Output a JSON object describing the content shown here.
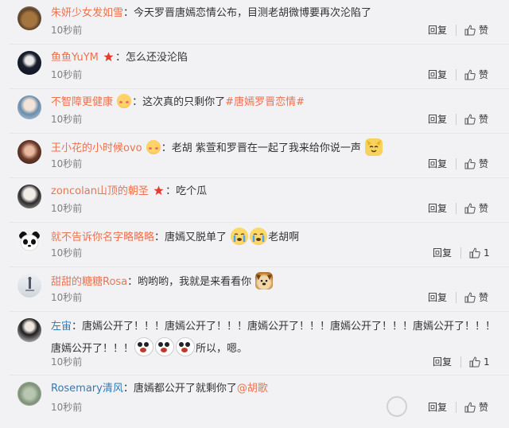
{
  "comments": [
    {
      "nick": "朱妍少女发如雪",
      "text": "：今天罗晋唐嫣恋情公布，目测老胡微博要再次沦陷了",
      "time": "10秒前",
      "reply": "回复",
      "like": "赞"
    },
    {
      "nick": "鱼鱼YuYM",
      "text": "：怎么还没沦陷",
      "time": "10秒前",
      "reply": "回复",
      "like": "赞"
    },
    {
      "nick": "不智障更健康",
      "text": "：这次真的只剩你了",
      "tag": "#唐嫣罗晋恋情#",
      "time": "10秒前",
      "reply": "回复",
      "like": "赞"
    },
    {
      "nick": "王小花的小时候ovo",
      "text": "：老胡 紫萱和罗晋在一起了我来给你说一声",
      "time": "10秒前",
      "reply": "回复",
      "like": "赞"
    },
    {
      "nick": "zoncolan山顶的朝圣",
      "text": "：吃个瓜",
      "time": "10秒前",
      "reply": "回复",
      "like": "赞"
    },
    {
      "nick": "就不告诉你名字略略略",
      "text": "：唐嫣又脱单了",
      "text2": "老胡啊",
      "time": "10秒前",
      "reply": "回复",
      "like": "1"
    },
    {
      "nick": "甜甜的糖糖Rosa",
      "text": "：哟哟哟，我就是来看看你",
      "time": "10秒前",
      "reply": "回复",
      "like": "赞"
    },
    {
      "nick": "左宙",
      "text": "：唐嫣公开了！！！唐嫣公开了！！！唐嫣公开了！！！唐嫣公开了！！！唐嫣公开了！！！",
      "text2": "唐嫣公开了！！！",
      "text3": "所以，嗯。",
      "time": "10秒前",
      "reply": "回复",
      "like": "1"
    },
    {
      "nick": "Rosemary清风",
      "text": "：唐嫣都公开了就剩你了",
      "mention": "@胡歌",
      "time": "10秒前",
      "reply": "回复",
      "like": "赞"
    }
  ],
  "icons": {
    "thumb": "thumbs-up-icon",
    "vip": "red-star-badge-icon"
  },
  "colors": {
    "nick": "#eb7350",
    "link": "#eb7350",
    "bg": "#f2f2f5"
  }
}
